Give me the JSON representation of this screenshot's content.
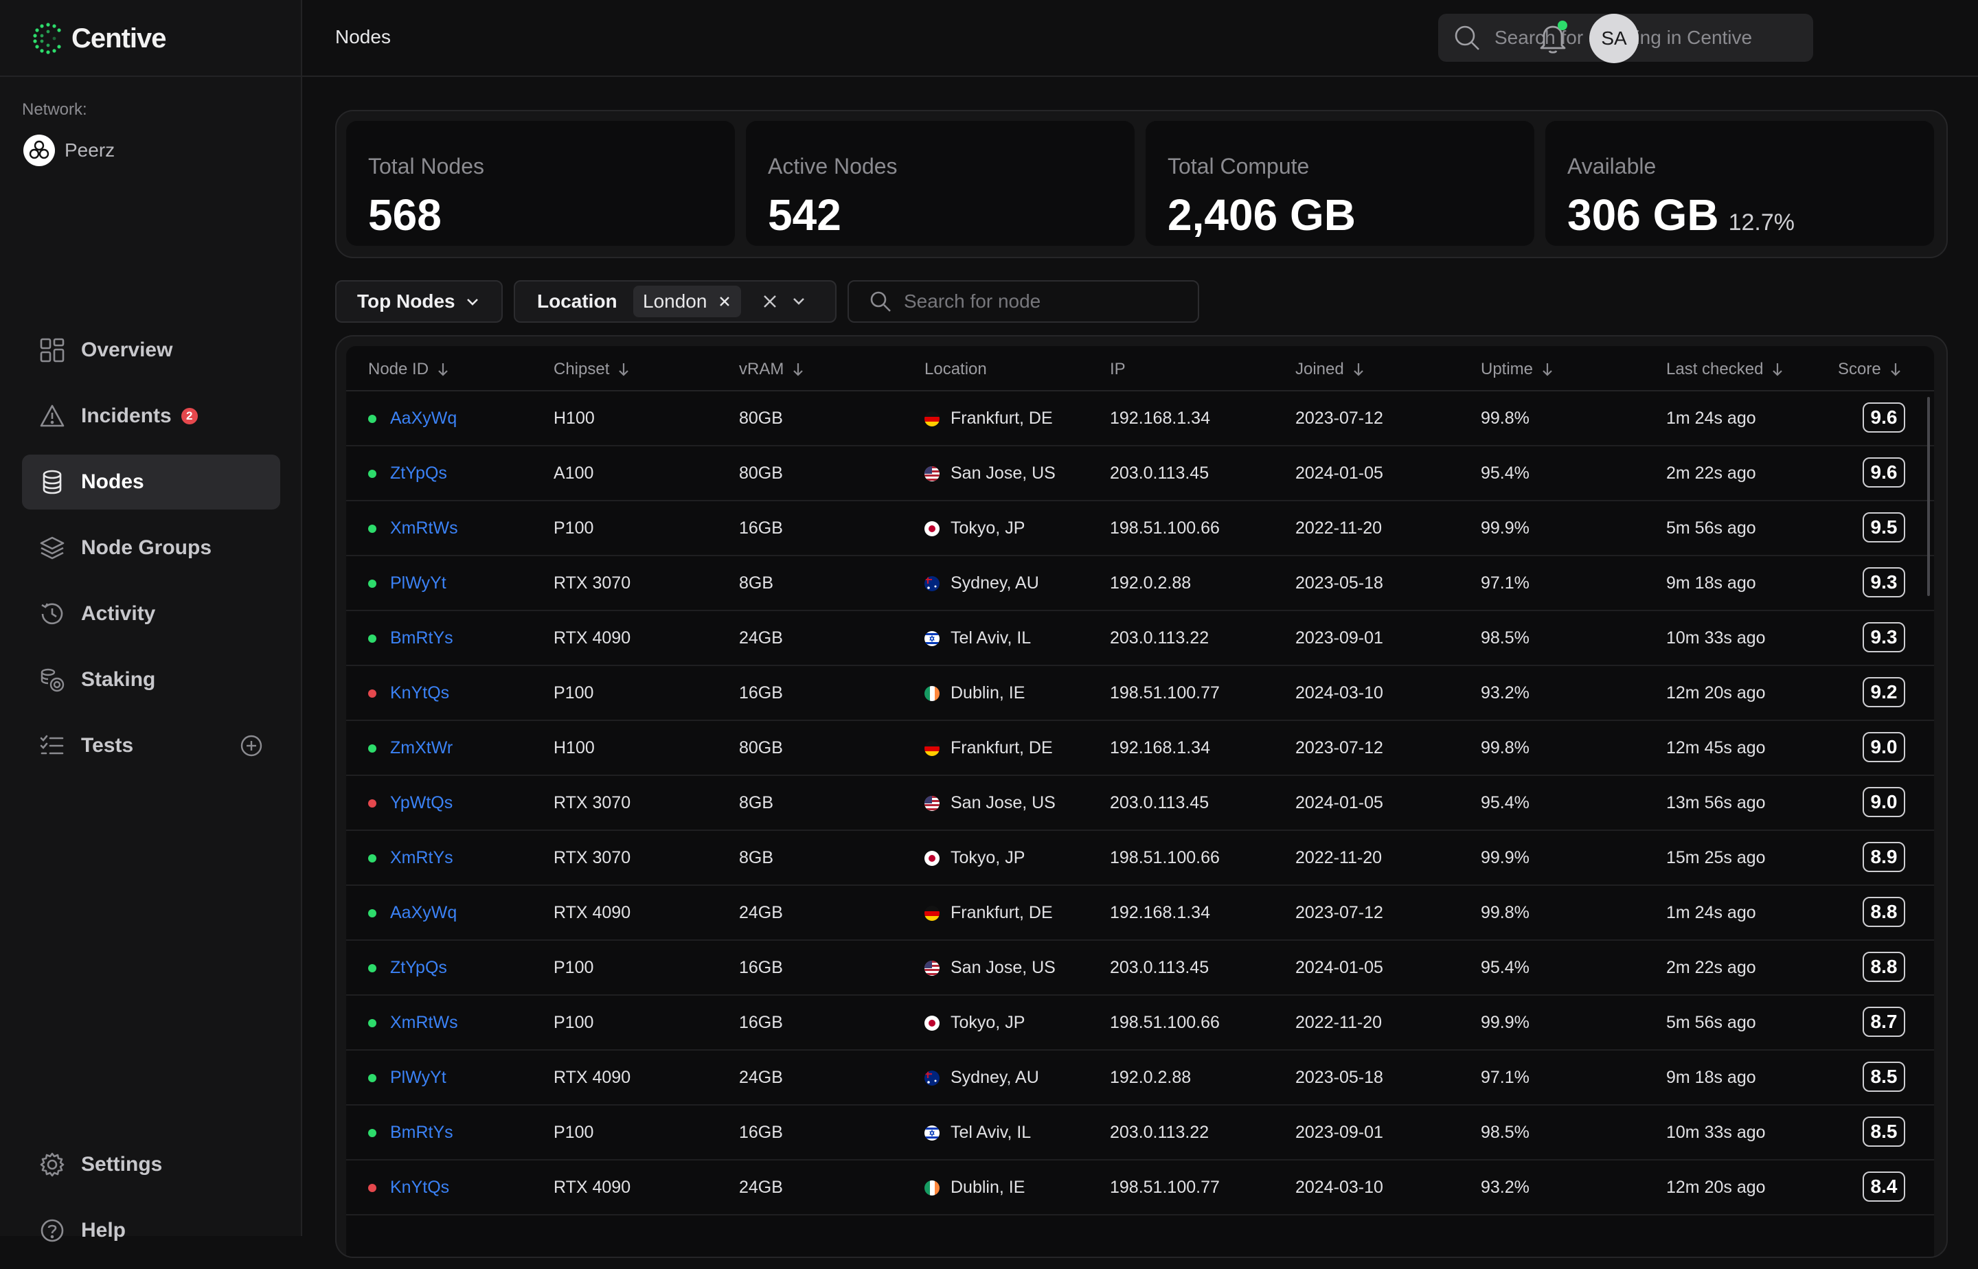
{
  "brand": {
    "name": "Centive",
    "accent": "#2ddc6b"
  },
  "topbar": {
    "title": "Nodes",
    "search_placeholder": "Search for anything in Centive",
    "avatar_initials": "SA"
  },
  "sidebar": {
    "network_label": "Network:",
    "network_name": "Peerz",
    "items": [
      {
        "label": "Overview",
        "icon": "grid-icon"
      },
      {
        "label": "Incidents",
        "icon": "alert-triangle-icon",
        "badge": "2"
      },
      {
        "label": "Nodes",
        "icon": "database-icon",
        "active": true
      },
      {
        "label": "Node Groups",
        "icon": "layers-icon"
      },
      {
        "label": "Activity",
        "icon": "history-icon"
      },
      {
        "label": "Staking",
        "icon": "coins-icon"
      },
      {
        "label": "Tests",
        "icon": "checklist-icon"
      }
    ],
    "bottom": [
      {
        "label": "Settings",
        "icon": "gear-icon"
      },
      {
        "label": "Help",
        "icon": "help-icon"
      }
    ]
  },
  "stats": [
    {
      "label": "Total Nodes",
      "value": "568"
    },
    {
      "label": "Active Nodes",
      "value": "542"
    },
    {
      "label": "Total Compute",
      "value": "2,406 GB"
    },
    {
      "label": "Available",
      "value": "306 GB",
      "sub": "12.7%"
    }
  ],
  "filters": {
    "top_nodes": "Top Nodes",
    "location_label": "Location",
    "location_value": "London",
    "search_placeholder": "Search for node"
  },
  "table": {
    "columns": [
      "Node ID",
      "Chipset",
      "vRAM",
      "Location",
      "IP",
      "Joined",
      "Uptime",
      "Last checked",
      "Score"
    ],
    "rows": [
      {
        "status": "up",
        "id": "AaXyWq",
        "chipset": "H100",
        "vram": "80GB",
        "flag": "de",
        "location": "Frankfurt, DE",
        "ip": "192.168.1.34",
        "joined": "2023-07-12",
        "uptime": "99.8%",
        "last": "1m 24s ago",
        "score": "9.6"
      },
      {
        "status": "up",
        "id": "ZtYpQs",
        "chipset": "A100",
        "vram": "80GB",
        "flag": "us",
        "location": "San Jose, US",
        "ip": "203.0.113.45",
        "joined": "2024-01-05",
        "uptime": "95.4%",
        "last": "2m 22s ago",
        "score": "9.6"
      },
      {
        "status": "up",
        "id": "XmRtWs",
        "chipset": "P100",
        "vram": "16GB",
        "flag": "jp",
        "location": "Tokyo, JP",
        "ip": "198.51.100.66",
        "joined": "2022-11-20",
        "uptime": "99.9%",
        "last": "5m 56s ago",
        "score": "9.5"
      },
      {
        "status": "up",
        "id": "PlWyYt",
        "chipset": "RTX 3070",
        "vram": "8GB",
        "flag": "au",
        "location": "Sydney, AU",
        "ip": "192.0.2.88",
        "joined": "2023-05-18",
        "uptime": "97.1%",
        "last": "9m 18s ago",
        "score": "9.3"
      },
      {
        "status": "up",
        "id": "BmRtYs",
        "chipset": "RTX 4090",
        "vram": "24GB",
        "flag": "il",
        "location": "Tel Aviv, IL",
        "ip": "203.0.113.22",
        "joined": "2023-09-01",
        "uptime": "98.5%",
        "last": "10m 33s ago",
        "score": "9.3"
      },
      {
        "status": "down",
        "id": "KnYtQs",
        "chipset": "P100",
        "vram": "16GB",
        "flag": "ie",
        "location": "Dublin, IE",
        "ip": "198.51.100.77",
        "joined": "2024-03-10",
        "uptime": "93.2%",
        "last": "12m 20s ago",
        "score": "9.2"
      },
      {
        "status": "up",
        "id": "ZmXtWr",
        "chipset": "H100",
        "vram": "80GB",
        "flag": "de",
        "location": "Frankfurt, DE",
        "ip": "192.168.1.34",
        "joined": "2023-07-12",
        "uptime": "99.8%",
        "last": "12m 45s ago",
        "score": "9.0"
      },
      {
        "status": "down",
        "id": "YpWtQs",
        "chipset": "RTX 3070",
        "vram": "8GB",
        "flag": "us",
        "location": "San Jose, US",
        "ip": "203.0.113.45",
        "joined": "2024-01-05",
        "uptime": "95.4%",
        "last": "13m 56s ago",
        "score": "9.0"
      },
      {
        "status": "up",
        "id": "XmRtYs",
        "chipset": "RTX 3070",
        "vram": "8GB",
        "flag": "jp",
        "location": "Tokyo, JP",
        "ip": "198.51.100.66",
        "joined": "2022-11-20",
        "uptime": "99.9%",
        "last": "15m 25s ago",
        "score": "8.9"
      },
      {
        "status": "up",
        "id": "AaXyWq",
        "chipset": "RTX 4090",
        "vram": "24GB",
        "flag": "de",
        "location": "Frankfurt, DE",
        "ip": "192.168.1.34",
        "joined": "2023-07-12",
        "uptime": "99.8%",
        "last": "1m 24s ago",
        "score": "8.8"
      },
      {
        "status": "up",
        "id": "ZtYpQs",
        "chipset": "P100",
        "vram": "16GB",
        "flag": "us",
        "location": "San Jose, US",
        "ip": "203.0.113.45",
        "joined": "2024-01-05",
        "uptime": "95.4%",
        "last": "2m 22s ago",
        "score": "8.8"
      },
      {
        "status": "up",
        "id": "XmRtWs",
        "chipset": "P100",
        "vram": "16GB",
        "flag": "jp",
        "location": "Tokyo, JP",
        "ip": "198.51.100.66",
        "joined": "2022-11-20",
        "uptime": "99.9%",
        "last": "5m 56s ago",
        "score": "8.7"
      },
      {
        "status": "up",
        "id": "PlWyYt",
        "chipset": "RTX 4090",
        "vram": "24GB",
        "flag": "au",
        "location": "Sydney, AU",
        "ip": "192.0.2.88",
        "joined": "2023-05-18",
        "uptime": "97.1%",
        "last": "9m 18s ago",
        "score": "8.5"
      },
      {
        "status": "up",
        "id": "BmRtYs",
        "chipset": "P100",
        "vram": "16GB",
        "flag": "il",
        "location": "Tel Aviv, IL",
        "ip": "203.0.113.22",
        "joined": "2023-09-01",
        "uptime": "98.5%",
        "last": "10m 33s ago",
        "score": "8.5"
      },
      {
        "status": "down",
        "id": "KnYtQs",
        "chipset": "RTX 4090",
        "vram": "24GB",
        "flag": "ie",
        "location": "Dublin, IE",
        "ip": "198.51.100.77",
        "joined": "2024-03-10",
        "uptime": "93.2%",
        "last": "12m 20s ago",
        "score": "8.4"
      }
    ]
  },
  "colors": {
    "status_up": "#2ddc6b",
    "status_down": "#e5484d",
    "link": "#3b82f6"
  }
}
